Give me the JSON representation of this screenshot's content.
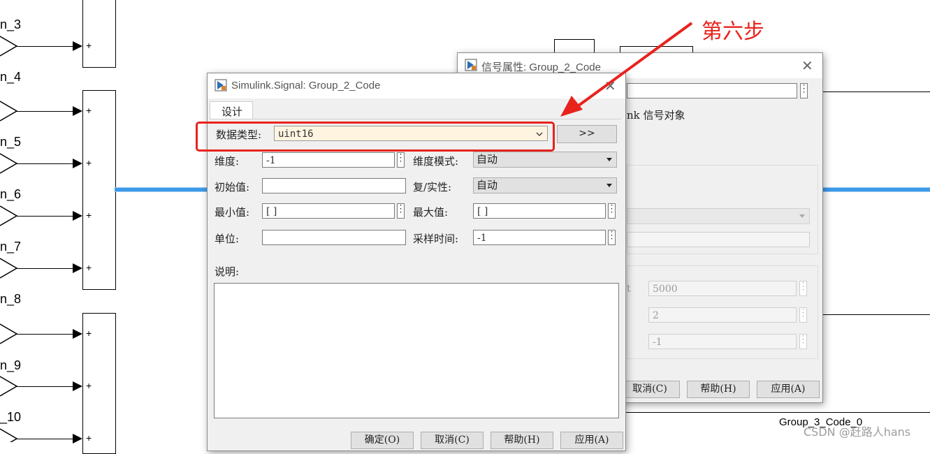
{
  "canvas": {
    "port_labels": [
      "n_3",
      "n_4",
      "n_5",
      "n_6",
      "n_7",
      "n_8",
      "n_9",
      "_10"
    ],
    "sum_sign": "+",
    "bottom_signal_label": "Group_3_Code_0"
  },
  "annotation": {
    "step_text": "第六步",
    "color": "#e8231d"
  },
  "watermark": "CSDN @赶路人hans",
  "back_dialog": {
    "title": "信号属性: Group_2_Code",
    "close_label": "✕",
    "partial_text": "nk 信号对象",
    "fields": {
      "partial_label": "t",
      "value1": "5000",
      "value2": "2",
      "value3": "-1"
    },
    "buttons": {
      "cancel": "取消(C)",
      "help": "帮助(H)",
      "apply": "应用(A)"
    }
  },
  "main_dialog": {
    "title": "Simulink.Signal: Group_2_Code",
    "close_label": "✕",
    "tab": "设计",
    "data_type": {
      "label": "数据类型:",
      "value": "uint16",
      "expand_button": ">>"
    },
    "dimensions": {
      "label": "维度:",
      "value": "-1"
    },
    "dimension_mode": {
      "label": "维度模式:",
      "value": "自动"
    },
    "initial_value": {
      "label": "初始值:",
      "value": ""
    },
    "complexity": {
      "label": "复/实性:",
      "value": "自动"
    },
    "min": {
      "label": "最小值:",
      "value": "[ ]"
    },
    "max": {
      "label": "最大值:",
      "value": "[ ]"
    },
    "unit": {
      "label": "单位:",
      "value": ""
    },
    "sample_time": {
      "label": "采样时间:",
      "value": "-1"
    },
    "description": {
      "label": "说明:",
      "value": ""
    },
    "buttons": {
      "ok": "确定(O)",
      "cancel": "取消(C)",
      "help": "帮助(H)",
      "apply": "应用(A)"
    }
  }
}
